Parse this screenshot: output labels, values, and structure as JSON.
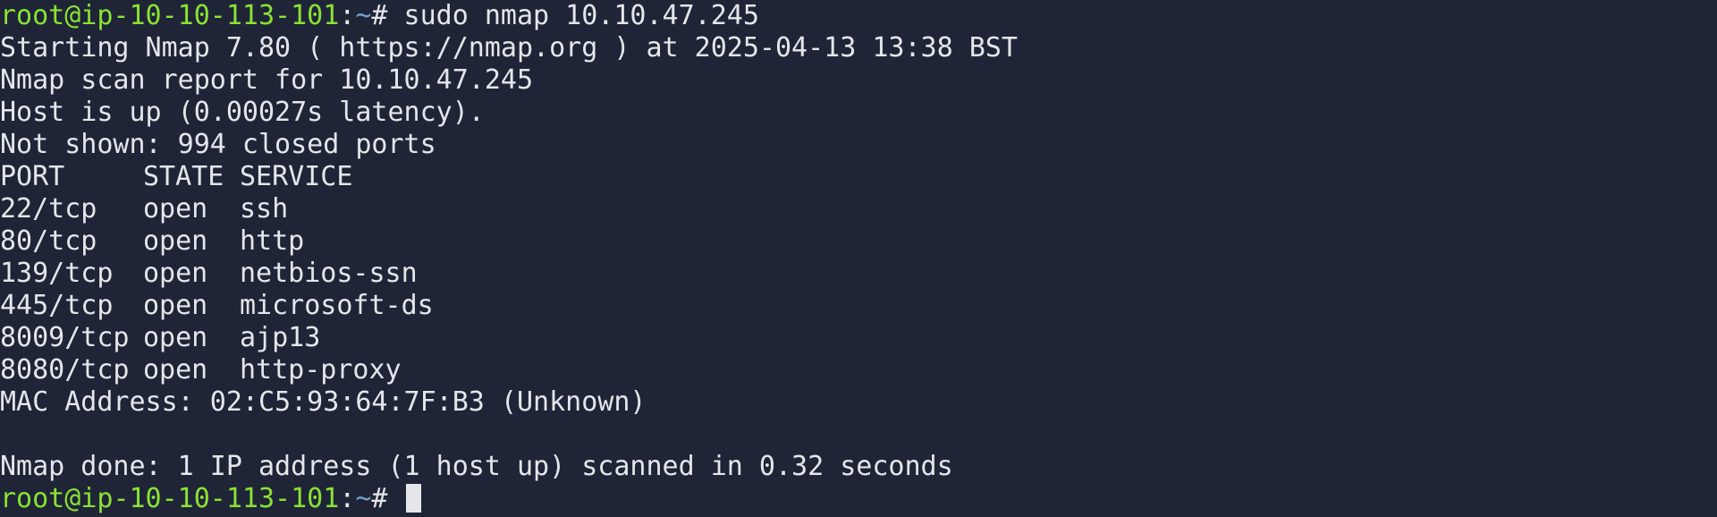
{
  "prompt": {
    "user_host": "root@ip-10-10-113-101",
    "separator": ":",
    "path": "~",
    "symbol": "# ",
    "command": "sudo nmap 10.10.47.245"
  },
  "output": {
    "starting": "Starting Nmap 7.80 ( https://nmap.org ) at 2025-04-13 13:38 BST",
    "report": "Nmap scan report for 10.10.47.245",
    "host_up": "Host is up (0.00027s latency).",
    "not_shown": "Not shown: 994 closed ports",
    "table_header": {
      "port": "PORT",
      "state": "STATE",
      "service": "SERVICE"
    },
    "ports": [
      {
        "port": "22/tcp",
        "state": "open",
        "service": "ssh"
      },
      {
        "port": "80/tcp",
        "state": "open",
        "service": "http"
      },
      {
        "port": "139/tcp",
        "state": "open",
        "service": "netbios-ssn"
      },
      {
        "port": "445/tcp",
        "state": "open",
        "service": "microsoft-ds"
      },
      {
        "port": "8009/tcp",
        "state": "open",
        "service": "ajp13"
      },
      {
        "port": "8080/tcp",
        "state": "open",
        "service": "http-proxy"
      }
    ],
    "mac": "MAC Address: 02:C5:93:64:7F:B3 (Unknown)",
    "done": "Nmap done: 1 IP address (1 host up) scanned in 0.32 seconds"
  },
  "colors": {
    "background": "#1f2537",
    "text": "#e4e6ea",
    "prompt_user": "#8ae234",
    "prompt_path": "#729fcf"
  }
}
